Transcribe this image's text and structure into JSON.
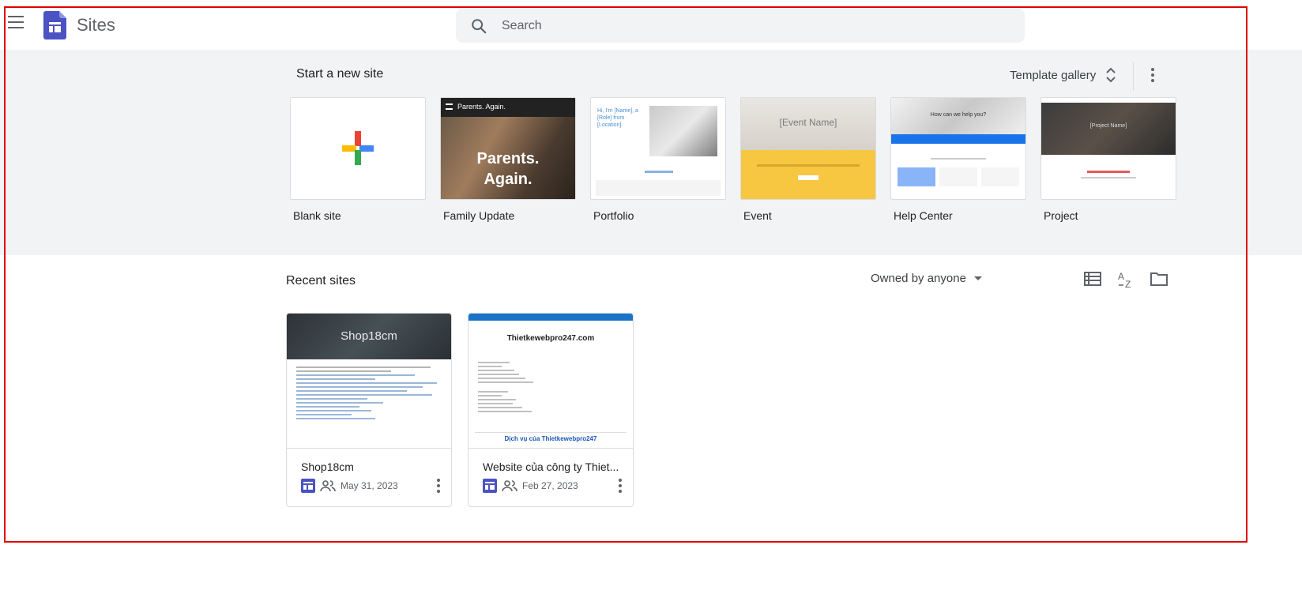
{
  "app": {
    "title": "Sites",
    "brand_color": "#4b52c2"
  },
  "search": {
    "placeholder": "Search"
  },
  "templates_section": {
    "title": "Start a new site",
    "gallery_label": "Template gallery",
    "templates": [
      {
        "label": "Blank site"
      },
      {
        "label": "Family Update",
        "thumb_text": "Parents. Again.",
        "thumb_header": "Parents. Again."
      },
      {
        "label": "Portfolio",
        "thumb_text": "Hi, I'm [Name], a [Role] from [Location]."
      },
      {
        "label": "Event",
        "thumb_text": "[Event Name]"
      },
      {
        "label": "Help Center",
        "thumb_text": "How can we help you?"
      },
      {
        "label": "Project",
        "thumb_text": "[Project Name]"
      }
    ]
  },
  "recent_section": {
    "title": "Recent sites",
    "filter_label": "Owned by anyone",
    "sites": [
      {
        "name": "Shop18cm",
        "date": "May 31, 2023",
        "thumb_title": "Shop18cm"
      },
      {
        "name": "Website của công ty Thiet...",
        "date": "Feb 27, 2023",
        "thumb_title": "Thietkewebpro247.com",
        "thumb_footer": "Dịch vụ của Thietkewebpro247"
      }
    ]
  },
  "icons": {
    "menu": "hamburger-icon",
    "search": "search-icon",
    "sort": "unfold-icon",
    "more": "more-vert-icon",
    "list_view": "list-view-icon",
    "sort_az": "sort-az-icon",
    "folder": "folder-icon",
    "site": "site-icon",
    "shared": "people-icon"
  },
  "colors": {
    "accent": "#1a73e8",
    "band": "#f1f3f4",
    "frame": "#e00000"
  }
}
